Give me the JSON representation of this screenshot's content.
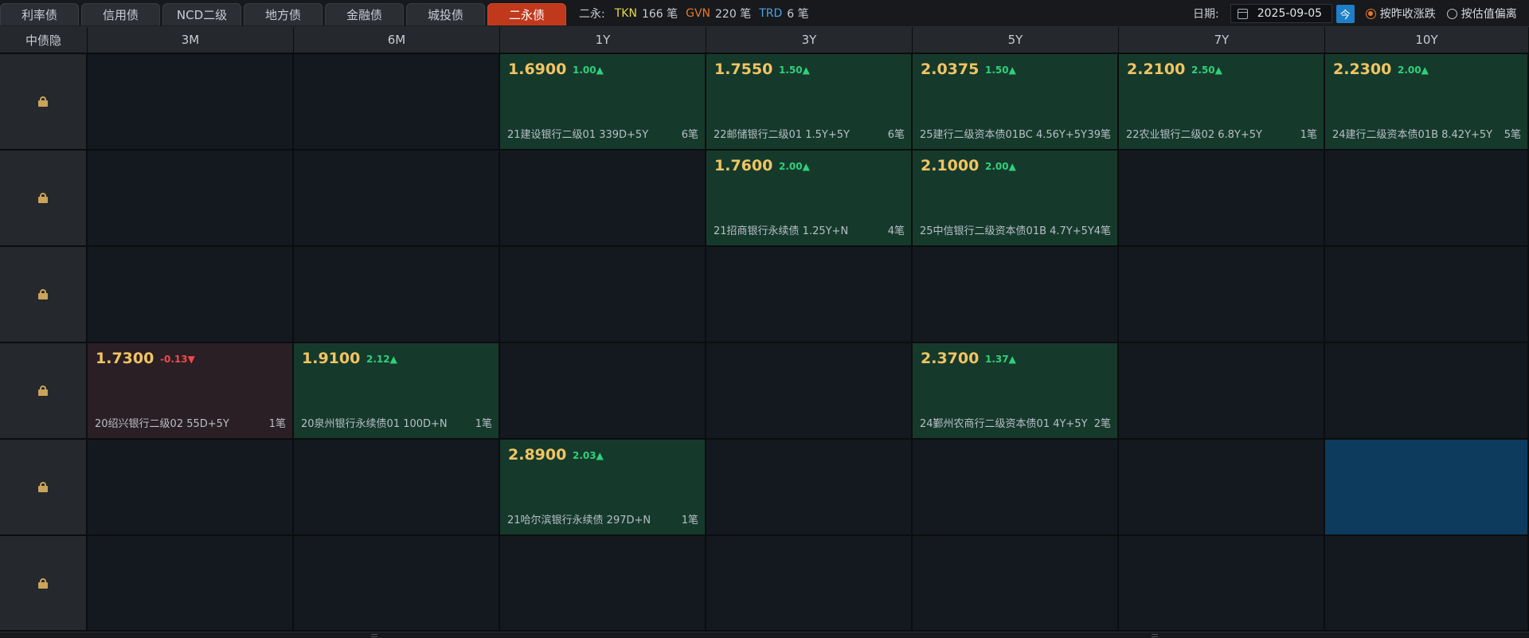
{
  "tabs": [
    {
      "label": "利率债",
      "active": false
    },
    {
      "label": "信用债",
      "active": false
    },
    {
      "label": "NCD二级",
      "active": false
    },
    {
      "label": "地方债",
      "active": false
    },
    {
      "label": "金融债",
      "active": false
    },
    {
      "label": "城投债",
      "active": false
    },
    {
      "label": "二永债",
      "active": true
    }
  ],
  "summary": {
    "label": "二永:",
    "tkn_label": "TKN",
    "tkn_count": "166 笔",
    "gvn_label": "GVN",
    "gvn_count": "220 笔",
    "trd_label": "TRD",
    "trd_count": "6 笔"
  },
  "date": {
    "label": "日期:",
    "value": "2025-09-05",
    "today_label": "今",
    "calendar_icon": "calendar-icon"
  },
  "mode_options": [
    {
      "label": "按昨收涨跌",
      "selected": true
    },
    {
      "label": "按估值偏离",
      "selected": false
    }
  ],
  "corner_label": "中债隐",
  "tenors": [
    "3M",
    "6M",
    "1Y",
    "3Y",
    "5Y",
    "7Y",
    "10Y"
  ],
  "row_icon": "lock-icon",
  "rows": [
    [
      null,
      null,
      {
        "yield": "1.6900",
        "change": "1.00▲",
        "name": "21建设银行二级01 339D+5Y",
        "trades": "6笔",
        "dir": "up"
      },
      {
        "yield": "1.7550",
        "change": "1.50▲",
        "name": "22邮储银行二级01 1.5Y+5Y",
        "trades": "6笔",
        "dir": "up"
      },
      {
        "yield": "2.0375",
        "change": "1.50▲",
        "name": "25建行二级资本债01BC 4.56Y+5Y",
        "trades": "39笔",
        "dir": "up"
      },
      {
        "yield": "2.2100",
        "change": "2.50▲",
        "name": "22农业银行二级02 6.8Y+5Y",
        "trades": "1笔",
        "dir": "up"
      },
      {
        "yield": "2.2300",
        "change": "2.00▲",
        "name": "24建行二级资本债01B 8.42Y+5Y",
        "trades": "5笔",
        "dir": "up"
      }
    ],
    [
      null,
      null,
      null,
      {
        "yield": "1.7600",
        "change": "2.00▲",
        "name": "21招商银行永续债 1.25Y+N",
        "trades": "4笔",
        "dir": "up"
      },
      {
        "yield": "2.1000",
        "change": "2.00▲",
        "name": "25中信银行二级资本债01B 4.7Y+5Y",
        "trades": "4笔",
        "dir": "up"
      },
      null,
      null
    ],
    [
      null,
      null,
      null,
      null,
      null,
      null,
      null
    ],
    [
      {
        "yield": "1.7300",
        "change": "-0.13▼",
        "name": "20绍兴银行二级02 55D+5Y",
        "trades": "1笔",
        "dir": "down"
      },
      {
        "yield": "1.9100",
        "change": "2.12▲",
        "name": "20泉州银行永续债01 100D+N",
        "trades": "1笔",
        "dir": "up"
      },
      null,
      null,
      {
        "yield": "2.3700",
        "change": "1.37▲",
        "name": "24鄞州农商行二级资本债01 4Y+5Y",
        "trades": "2笔",
        "dir": "up"
      },
      null,
      null
    ],
    [
      null,
      null,
      {
        "yield": "2.8900",
        "change": "2.03▲",
        "name": "21哈尔滨银行永续债 297D+N",
        "trades": "1笔",
        "dir": "up"
      },
      null,
      null,
      null,
      {
        "dir": "sel"
      }
    ],
    [
      null,
      null,
      null,
      null,
      null,
      null,
      null
    ]
  ],
  "colors": {
    "accent_tab": "#c0391d",
    "up": "#2fd07a",
    "down": "#f04a4a",
    "yield": "#f2c462",
    "tkn": "#e8d84a",
    "gvn": "#e8782b",
    "trd": "#4aa3e8"
  }
}
